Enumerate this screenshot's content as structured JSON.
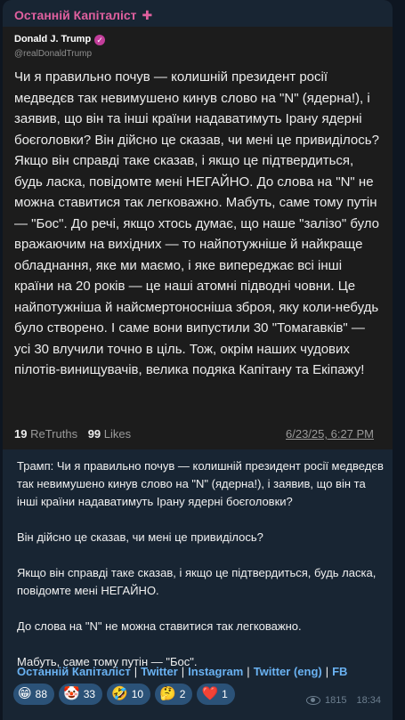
{
  "channel": {
    "name": "Останній Капіталіст",
    "badge": "✚"
  },
  "post": {
    "author": "Donald J. Trump",
    "verified_icon": "verified-badge",
    "handle": "@realDonaldTrump",
    "text": "Чи я правильно почув — колишній президент росії медведєв так невимушено кинув слово на \"N\" (ядерна!), і заявив, що він та інші країни надаватимуть Ірану ядерні боєголовки? Він дійсно це сказав, чи мені це привиділось? Якщо він справді таке сказав, і якщо це підтвердиться, будь ласка, повідомте мені НЕГАЙНО. До слова на \"N\" не можна ставитися так легковажно. Мабуть, саме тому путін — \"Бос\". До речі, якщо хтось думає, що наше \"залізо\" було вражаючим на вихідних — то найпотужніше й найкраще обладнання, яке ми маємо, і яке випереджає всі інші країни на 20 років — це наші атомні підводні човни. Це найпотужніша й найсмертоносніша зброя, яку коли-небудь було створено. І саме вони випустили 30 \"Томагавків\" — усі 30 влучили точно в ціль. Тож, окрім наших чудових пілотів-винищувачів, велика подяка Капітану та Екіпажу!",
    "retruths_count": "19",
    "retruths_label": "ReTruths",
    "likes_count": "99",
    "likes_label": "Likes",
    "date": "6/23/25, 6:27 PM"
  },
  "translation": "Трамп: Чи я правильно почув — колишній президент росії медведєв так невимушено кинув слово на \"N\" (ядерна!), і заявив, що він та інші країни надаватимуть Ірану ядерні боєголовки?\n\nВін дійсно це сказав, чи мені це привиділось?\n\nЯкщо він справді таке сказав, і якщо це підтвердиться, будь ласка, повідомте мені НЕГАЙНО.\n\nДо слова на \"N\" не можна ставитися так легковажно.\n\nМабуть, саме тому путін — \"Бос\".",
  "links": [
    {
      "label": "Останній Капіталіст"
    },
    {
      "label": "Twitter"
    },
    {
      "label": "Instagram"
    },
    {
      "label": "Twitter (eng)"
    },
    {
      "label": "FB"
    }
  ],
  "link_separator": "|",
  "reactions": [
    {
      "emoji": "😁",
      "count": "88"
    },
    {
      "emoji": "🤡",
      "count": "33"
    },
    {
      "emoji": "🤣",
      "count": "10"
    },
    {
      "emoji": "🤔",
      "count": "2"
    },
    {
      "emoji": "❤️",
      "count": "1"
    }
  ],
  "views": "1815",
  "time": "18:34",
  "colors": {
    "background": "#0e1621",
    "bubble": "#182533",
    "card": "#1c1c1c",
    "channel_name": "#e0609f",
    "link": "#6ab2f2",
    "reaction_bg": "#2b5278"
  }
}
